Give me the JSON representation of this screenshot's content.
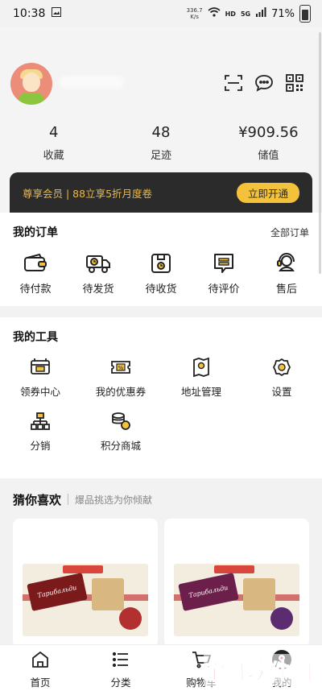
{
  "status_bar": {
    "time": "10:38",
    "net_speed_value": "336.7",
    "net_speed_unit": "K/s",
    "hd": "HD",
    "network": "5G",
    "battery": "71%"
  },
  "stats": [
    {
      "value": "4",
      "label": "收藏"
    },
    {
      "value": "48",
      "label": "足迹"
    },
    {
      "value": "¥909.56",
      "label": "储值"
    }
  ],
  "vip": {
    "text": "尊享会员 | 88立享5折月度卷",
    "button": "立即开通"
  },
  "orders": {
    "title": "我的订单",
    "all_link": "全部订单",
    "items": [
      {
        "label": "待付款",
        "icon": "wallet-icon"
      },
      {
        "label": "待发货",
        "icon": "truck-icon"
      },
      {
        "label": "待收货",
        "icon": "package-icon"
      },
      {
        "label": "待评价",
        "icon": "review-icon"
      },
      {
        "label": "售后",
        "icon": "headset-icon"
      }
    ]
  },
  "tools": {
    "title": "我的工具",
    "items": [
      {
        "label": "领券中心",
        "icon": "coupon-center-icon"
      },
      {
        "label": "我的优惠券",
        "icon": "ticket-icon"
      },
      {
        "label": "地址管理",
        "icon": "location-icon"
      },
      {
        "label": "设置",
        "icon": "gear-icon"
      },
      {
        "label": "分销",
        "icon": "distribution-icon"
      },
      {
        "label": "积分商城",
        "icon": "coins-icon"
      }
    ]
  },
  "recommend": {
    "title": "猜你喜欢",
    "subtitle": "爆品挑选为你倾献",
    "products": [
      {
        "brand": "Тарибальди",
        "color": "#7a1a1a"
      },
      {
        "brand": "Тарибальди",
        "color": "#6b1f4a"
      }
    ]
  },
  "bottom_nav": [
    {
      "label": "首页",
      "icon": "home-icon"
    },
    {
      "label": "分类",
      "icon": "list-icon"
    },
    {
      "label": "购物车",
      "icon": "cart-icon"
    },
    {
      "label": "我的",
      "icon": "user-icon"
    }
  ],
  "watermark": "宝哥软件园",
  "colors": {
    "accent": "#f3c23a",
    "vip_bg": "#2b2b2b",
    "vip_text": "#e8b84a"
  }
}
